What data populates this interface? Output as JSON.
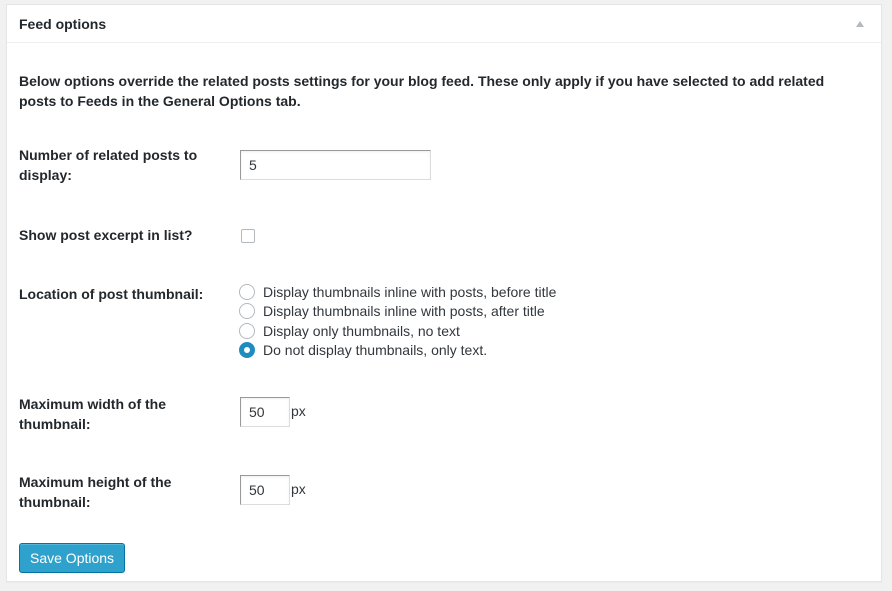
{
  "panel": {
    "title": "Feed options",
    "description": "Below options override the related posts settings for your blog feed. These only apply if you have selected to add related posts to Feeds in the General Options tab."
  },
  "fields": {
    "num_posts": {
      "label": "Number of related posts to display:",
      "value": "5"
    },
    "show_excerpt": {
      "label": "Show post excerpt in list?",
      "checked": false
    },
    "thumb_location": {
      "label": "Location of post thumbnail:",
      "options": [
        "Display thumbnails inline with posts, before title",
        "Display thumbnails inline with posts, after title",
        "Display only thumbnails, no text",
        "Do not display thumbnails, only text."
      ],
      "selected_index": 3
    },
    "max_width": {
      "label": "Maximum width of the thumbnail:",
      "value": "50",
      "unit": "px"
    },
    "max_height": {
      "label": "Maximum height of the thumbnail:",
      "value": "50",
      "unit": "px"
    }
  },
  "actions": {
    "save_label": "Save Options"
  },
  "colors": {
    "accent": "#2ea2cc",
    "radio_checked": "#1e8cbe"
  }
}
